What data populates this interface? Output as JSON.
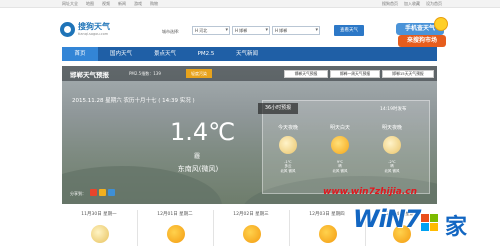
{
  "topbar": {
    "links_left": [
      "网址大全",
      "地图",
      "视频",
      "新闻",
      "游戏",
      "购物"
    ],
    "links_right": [
      "搜狗首页",
      "加入收藏",
      "设为首页"
    ]
  },
  "header": {
    "logo_title": "搜狗天气",
    "logo_sub": "tianqi.sogou.com",
    "city_label": "城市选择:",
    "select1": "H 河北",
    "select2": "H 邯郸",
    "select3": "H 邯郸",
    "query_button": "查看天气",
    "promo_line1": "手机查天气",
    "promo_line2": "来搜狗市场"
  },
  "nav": {
    "items": [
      "首页",
      "国内天气",
      "景点天气",
      "PM2.5",
      "天气新闻"
    ],
    "active_index": 0
  },
  "current": {
    "title": "邯郸天气预报",
    "pm": "PM2.5指数：139",
    "pm_badge": "轻度污染",
    "buttons": [
      "邯郸天气预报",
      "邯郸一周天气预报",
      "邯郸15天天气预报"
    ],
    "date": "2015.11.28 星期六 农历十月十七 ( 14:39 实况 )",
    "temperature": "1.4℃",
    "condition": "霾",
    "wind": "东南风(微风)",
    "share_label": "分享到："
  },
  "forecast36": {
    "title": "36小时预报",
    "published": "14:19时发布",
    "columns": [
      {
        "label": "今天夜晚",
        "icon": "moon-cloud-icon",
        "temp": "-1℃",
        "cond": "多云",
        "wind": "北风 微风"
      },
      {
        "label": "明天白天",
        "icon": "sun-icon",
        "temp": "9℃",
        "cond": "晴",
        "wind": "北风 微风"
      },
      {
        "label": "明天夜晚",
        "icon": "moon-icon",
        "temp": "-2℃",
        "cond": "晴",
        "wind": "北风 微风"
      }
    ]
  },
  "week": [
    {
      "day": "11月30日 星期一",
      "icon": "moon-icon"
    },
    {
      "day": "12月01日 星期二",
      "icon": "sun-icon"
    },
    {
      "day": "12月02日 星期三",
      "icon": "sun-icon"
    },
    {
      "day": "12月03日 星期四",
      "icon": "sun-icon"
    },
    {
      "day": "12月04日 星期五",
      "icon": "sun-icon"
    }
  ],
  "watermark": {
    "url": "www.win7zhijia.cn",
    "brand": "WiN7",
    "jia": "家"
  },
  "colors": {
    "nav_bg": "#1f5fa6",
    "nav_active": "#3385d6",
    "badge": "#e8a31c",
    "query_btn": "#2c78c7"
  }
}
